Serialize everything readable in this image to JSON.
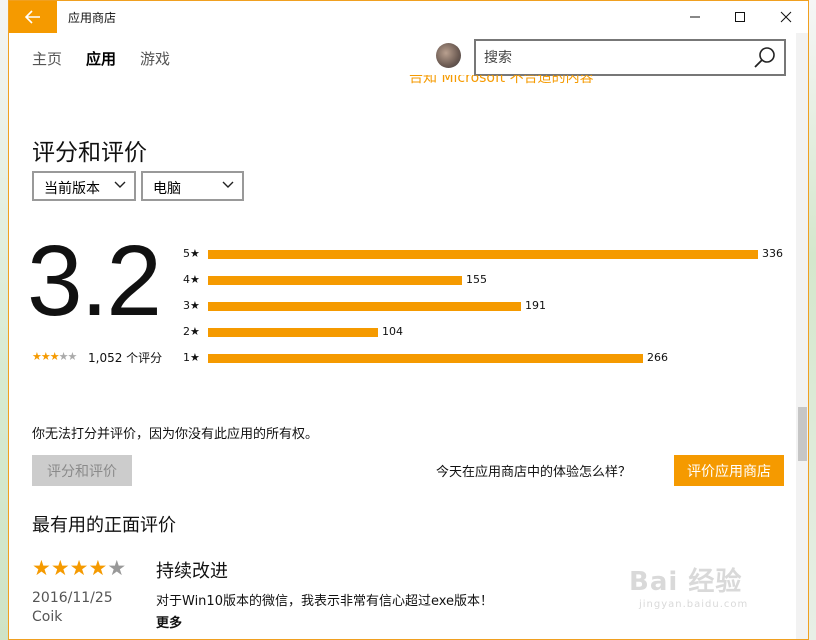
{
  "window": {
    "title": "应用商店"
  },
  "nav": {
    "items": [
      "主页",
      "应用",
      "游戏"
    ],
    "active": "应用",
    "search_placeholder": "搜索"
  },
  "top_link": "告知 Microsoft 不合适的内容",
  "ratings": {
    "section_title": "评分和评价",
    "version_filter": "当前版本",
    "device_filter": "电脑",
    "average": "3.2",
    "average_stars": 3.2,
    "review_count": "1,052 个评分",
    "distribution": [
      {
        "label": "5★",
        "count": 336
      },
      {
        "label": "4★",
        "count": 155
      },
      {
        "label": "3★",
        "count": 191
      },
      {
        "label": "2★",
        "count": 104
      },
      {
        "label": "1★",
        "count": 266
      }
    ],
    "distribution_text": [
      "336",
      "155",
      "191",
      "104",
      "266"
    ],
    "note": "你无法打分并评价，因为你没有此应用的所有权。",
    "rate_button": "评分和评价",
    "store_question": "今天在应用商店中的体验怎么样？",
    "store_button": "评价应用商店"
  },
  "reviews": {
    "section_title": "最有用的正面评价",
    "items": [
      {
        "stars": 4,
        "date": "2016/11/25",
        "author": "Coik",
        "title": "持续改进",
        "body": "对于Win10版本的微信，我表示非常有信心超过exe版本！",
        "more": "更多"
      }
    ]
  },
  "watermark": {
    "text": "Bai 经验",
    "sub": "jingyan.baidu.com"
  },
  "colors": {
    "accent": "#f59a00",
    "disabled": "#cccccc"
  }
}
